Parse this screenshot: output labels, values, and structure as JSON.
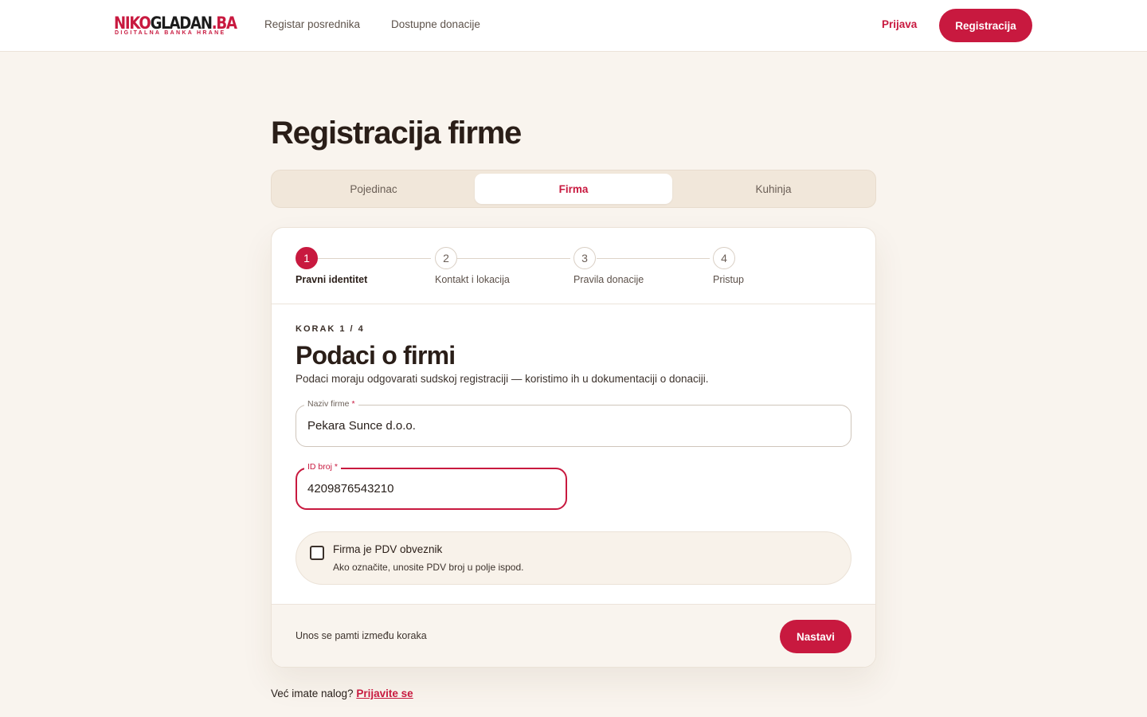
{
  "brand": {
    "name_part1": "NIKO",
    "name_part2": "GLADAN",
    "name_part3": ".BA",
    "tagline": "DIGITALNA BANKA HRANE",
    "accent_color": "#c8193f"
  },
  "nav": {
    "links": [
      "Registar posrednika",
      "Dostupne donacije"
    ],
    "login": "Prijava",
    "register": "Registracija"
  },
  "page": {
    "title": "Registracija firme"
  },
  "tabs": [
    {
      "label": "Pojedinac",
      "active": false
    },
    {
      "label": "Firma",
      "active": true
    },
    {
      "label": "Kuhinja",
      "active": false
    }
  ],
  "steps": [
    {
      "number": "1",
      "label": "Pravni identitet",
      "active": true
    },
    {
      "number": "2",
      "label": "Kontakt i lokacija",
      "active": false
    },
    {
      "number": "3",
      "label": "Pravila donacije",
      "active": false
    },
    {
      "number": "4",
      "label": "Pristup",
      "active": false
    }
  ],
  "form": {
    "kicker": "KORAK 1 / 4",
    "title": "Podaci o firmi",
    "description": "Podaci moraju odgovarati sudskoj registraciji — koristimo ih u dokumentaciji o donaciji.",
    "company_name": {
      "label": "Naziv firme",
      "required_mark": "*",
      "value": "Pekara Sunce d.o.o."
    },
    "id_number": {
      "label": "ID broj",
      "required_mark": "*",
      "value": "4209876543210"
    },
    "vat": {
      "label": "Firma je PDV obveznik",
      "hint": "Ako označite, unosite PDV broj u polje ispod.",
      "checked": false
    }
  },
  "footer": {
    "note": "Unos se pamti između koraka",
    "next": "Nastavi"
  },
  "account": {
    "question": "Već imate nalog?",
    "link": "Prijavite se"
  }
}
